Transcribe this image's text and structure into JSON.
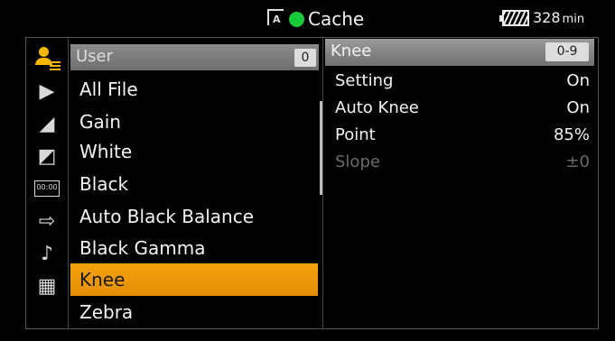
{
  "status_bar": {
    "mode_icon": "rec-mode-icon",
    "mode_text": "A",
    "cache_label": "Cache",
    "cache_color": "#18c93a",
    "battery_minutes": "328",
    "battery_unit": "min"
  },
  "categories": [
    {
      "icon": "user-menu-icon",
      "glyph": ""
    },
    {
      "icon": "camera-icon",
      "glyph": "▶"
    },
    {
      "icon": "clapper-icon",
      "glyph": "◢"
    },
    {
      "icon": "paint-icon",
      "glyph": "◩"
    },
    {
      "icon": "timecode-icon",
      "glyph": "00:00"
    },
    {
      "icon": "output-icon",
      "glyph": "⇨"
    },
    {
      "icon": "audio-icon",
      "glyph": "♪"
    },
    {
      "icon": "grid-icon",
      "glyph": "▦"
    }
  ],
  "list": {
    "header": "User",
    "page": "0",
    "items": [
      "All File",
      "Gain",
      "White",
      "Black",
      "Auto Black Balance",
      "Black Gamma",
      "Knee",
      "Zebra"
    ],
    "selected": "Knee"
  },
  "detail": {
    "title": "Knee",
    "range": "0-9",
    "rows": [
      {
        "label": "Setting",
        "value": "On"
      },
      {
        "label": "Auto Knee",
        "value": "On"
      },
      {
        "label": "Point",
        "value": "85%"
      },
      {
        "label": "Slope",
        "value": "±0"
      }
    ]
  },
  "colors": {
    "selection": "#f3a30c",
    "user_icon": "#f5b500",
    "disabled": "#6a6a6a"
  }
}
